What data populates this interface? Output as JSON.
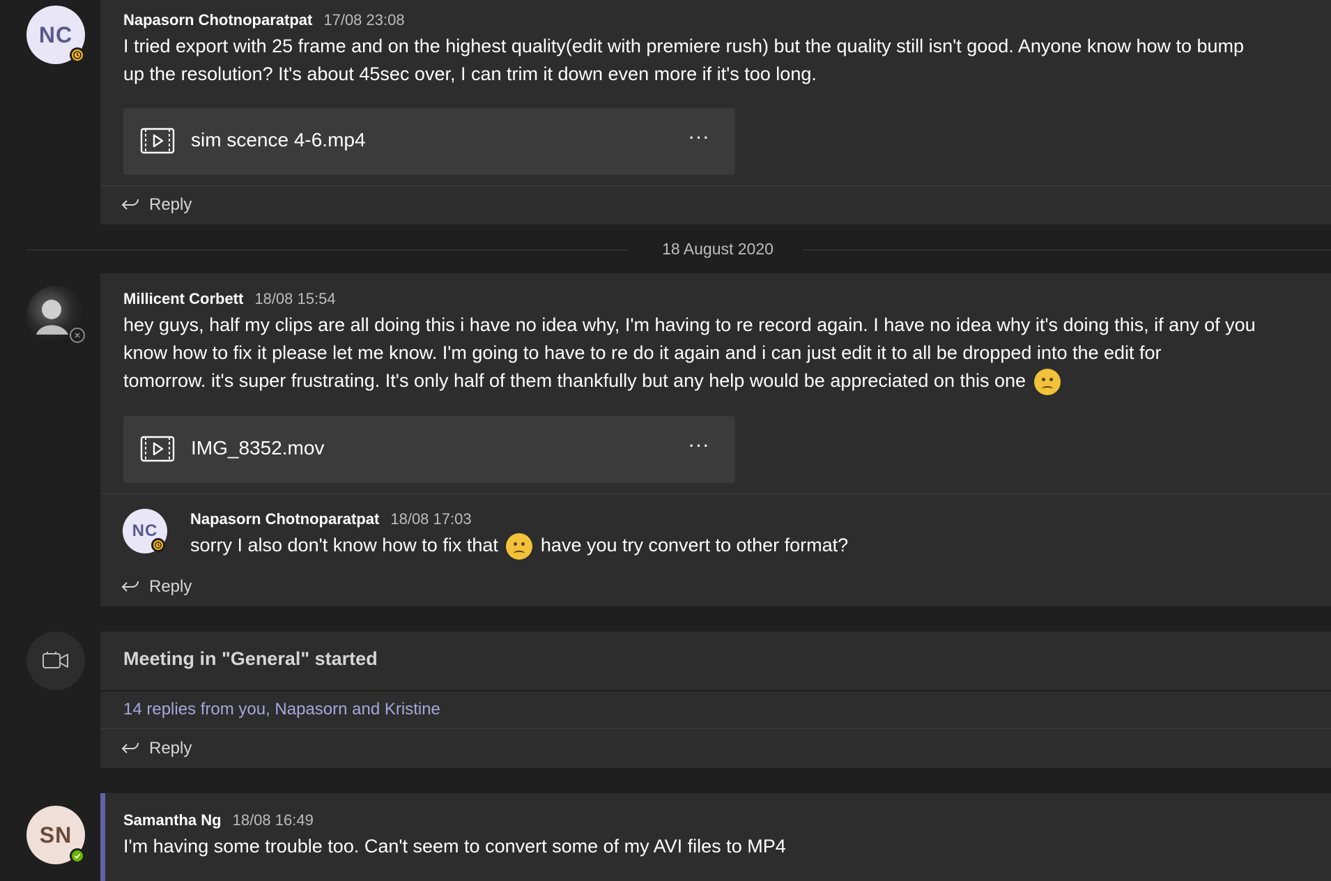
{
  "messages": [
    {
      "author": "Napasorn Chotnoparatpat",
      "initials": "NC",
      "time": "17/08 23:08",
      "text_lines": [
        "I tried export with 25 frame and on the highest quality(edit with premiere rush) but the quality still isn't good. Anyone know how to bump",
        "up the resolution? It's about 45sec over, I can trim it down even more if it's too long."
      ],
      "attachment": "sim scence 4-6.mp4",
      "presence": "away"
    },
    {
      "author": "Millicent Corbett",
      "time": "18/08 15:54",
      "text_lines": [
        "hey guys, half my clips are all doing this i have no idea why, I'm having to re record again. I have no idea why it's doing this, if any of you",
        "know how to fix it please let me know. I'm going to have to re do it again and i can just edit it to all be dropped into the edit for",
        "tomorrow. it's super frustrating. It's only half of them thankfully but any help would be appreciated on this one"
      ],
      "attachment": "IMG_8352.mov",
      "presence": "offline",
      "reply": {
        "author": "Napasorn Chotnoparatpat",
        "initials": "NC",
        "time": "18/08 17:03",
        "text_before": "sorry I also don't know how to fix that",
        "text_after": "have you try convert to other format?",
        "presence": "away"
      }
    },
    {
      "type": "meeting",
      "text": "Meeting in \"General\" started",
      "replies_summary": "14 replies from you, Napasorn and Kristine"
    },
    {
      "author": "Samantha Ng",
      "initials": "SN",
      "time": "18/08 16:49",
      "text": "I'm having some trouble too. Can't seem to convert some of my AVI files to MP4",
      "presence": "available"
    }
  ],
  "date_divider": "18 August 2020",
  "reply_label": "Reply",
  "more_label": "...",
  "colors": {
    "background": "#1f1f1f",
    "card": "#2d2d2d",
    "attachment": "#3b3b3b",
    "accent": "#6264a7",
    "link": "#a6a7dc",
    "away": "#fdb913",
    "available": "#6bb700"
  }
}
